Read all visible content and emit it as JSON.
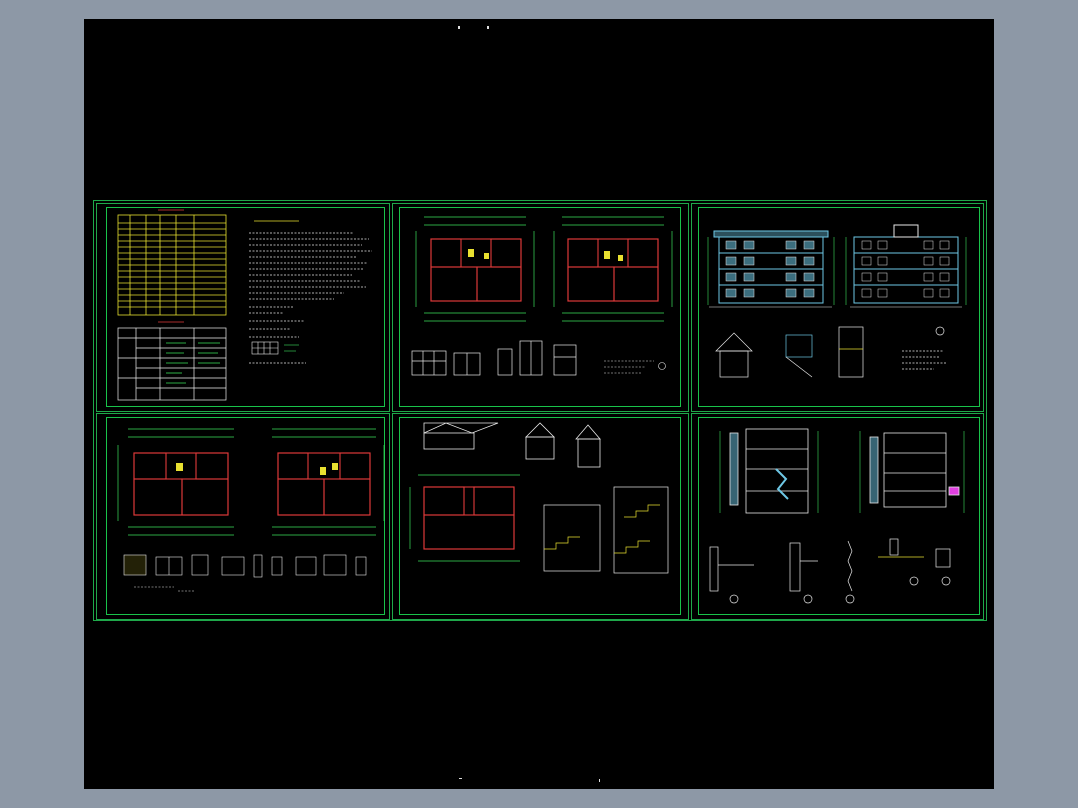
{
  "viewer": {
    "background_color": "#8d98a6",
    "canvas_color": "#000000",
    "frame_color": "#1fa84a"
  },
  "sheets": [
    {
      "name": "design-notes-sheet"
    },
    {
      "name": "floor-plans-sheet-1"
    },
    {
      "name": "elevations-sheet"
    },
    {
      "name": "floor-plans-sheet-2"
    },
    {
      "name": "roof-and-stair-sheet"
    },
    {
      "name": "sections-and-details-sheet"
    }
  ],
  "colors": {
    "wall": "#e03a3a",
    "dim": "#3ce05c",
    "text": "#e8e8e8",
    "table": "#e8e030",
    "facade": "#6ec8e6",
    "accent": "#e040e0"
  }
}
